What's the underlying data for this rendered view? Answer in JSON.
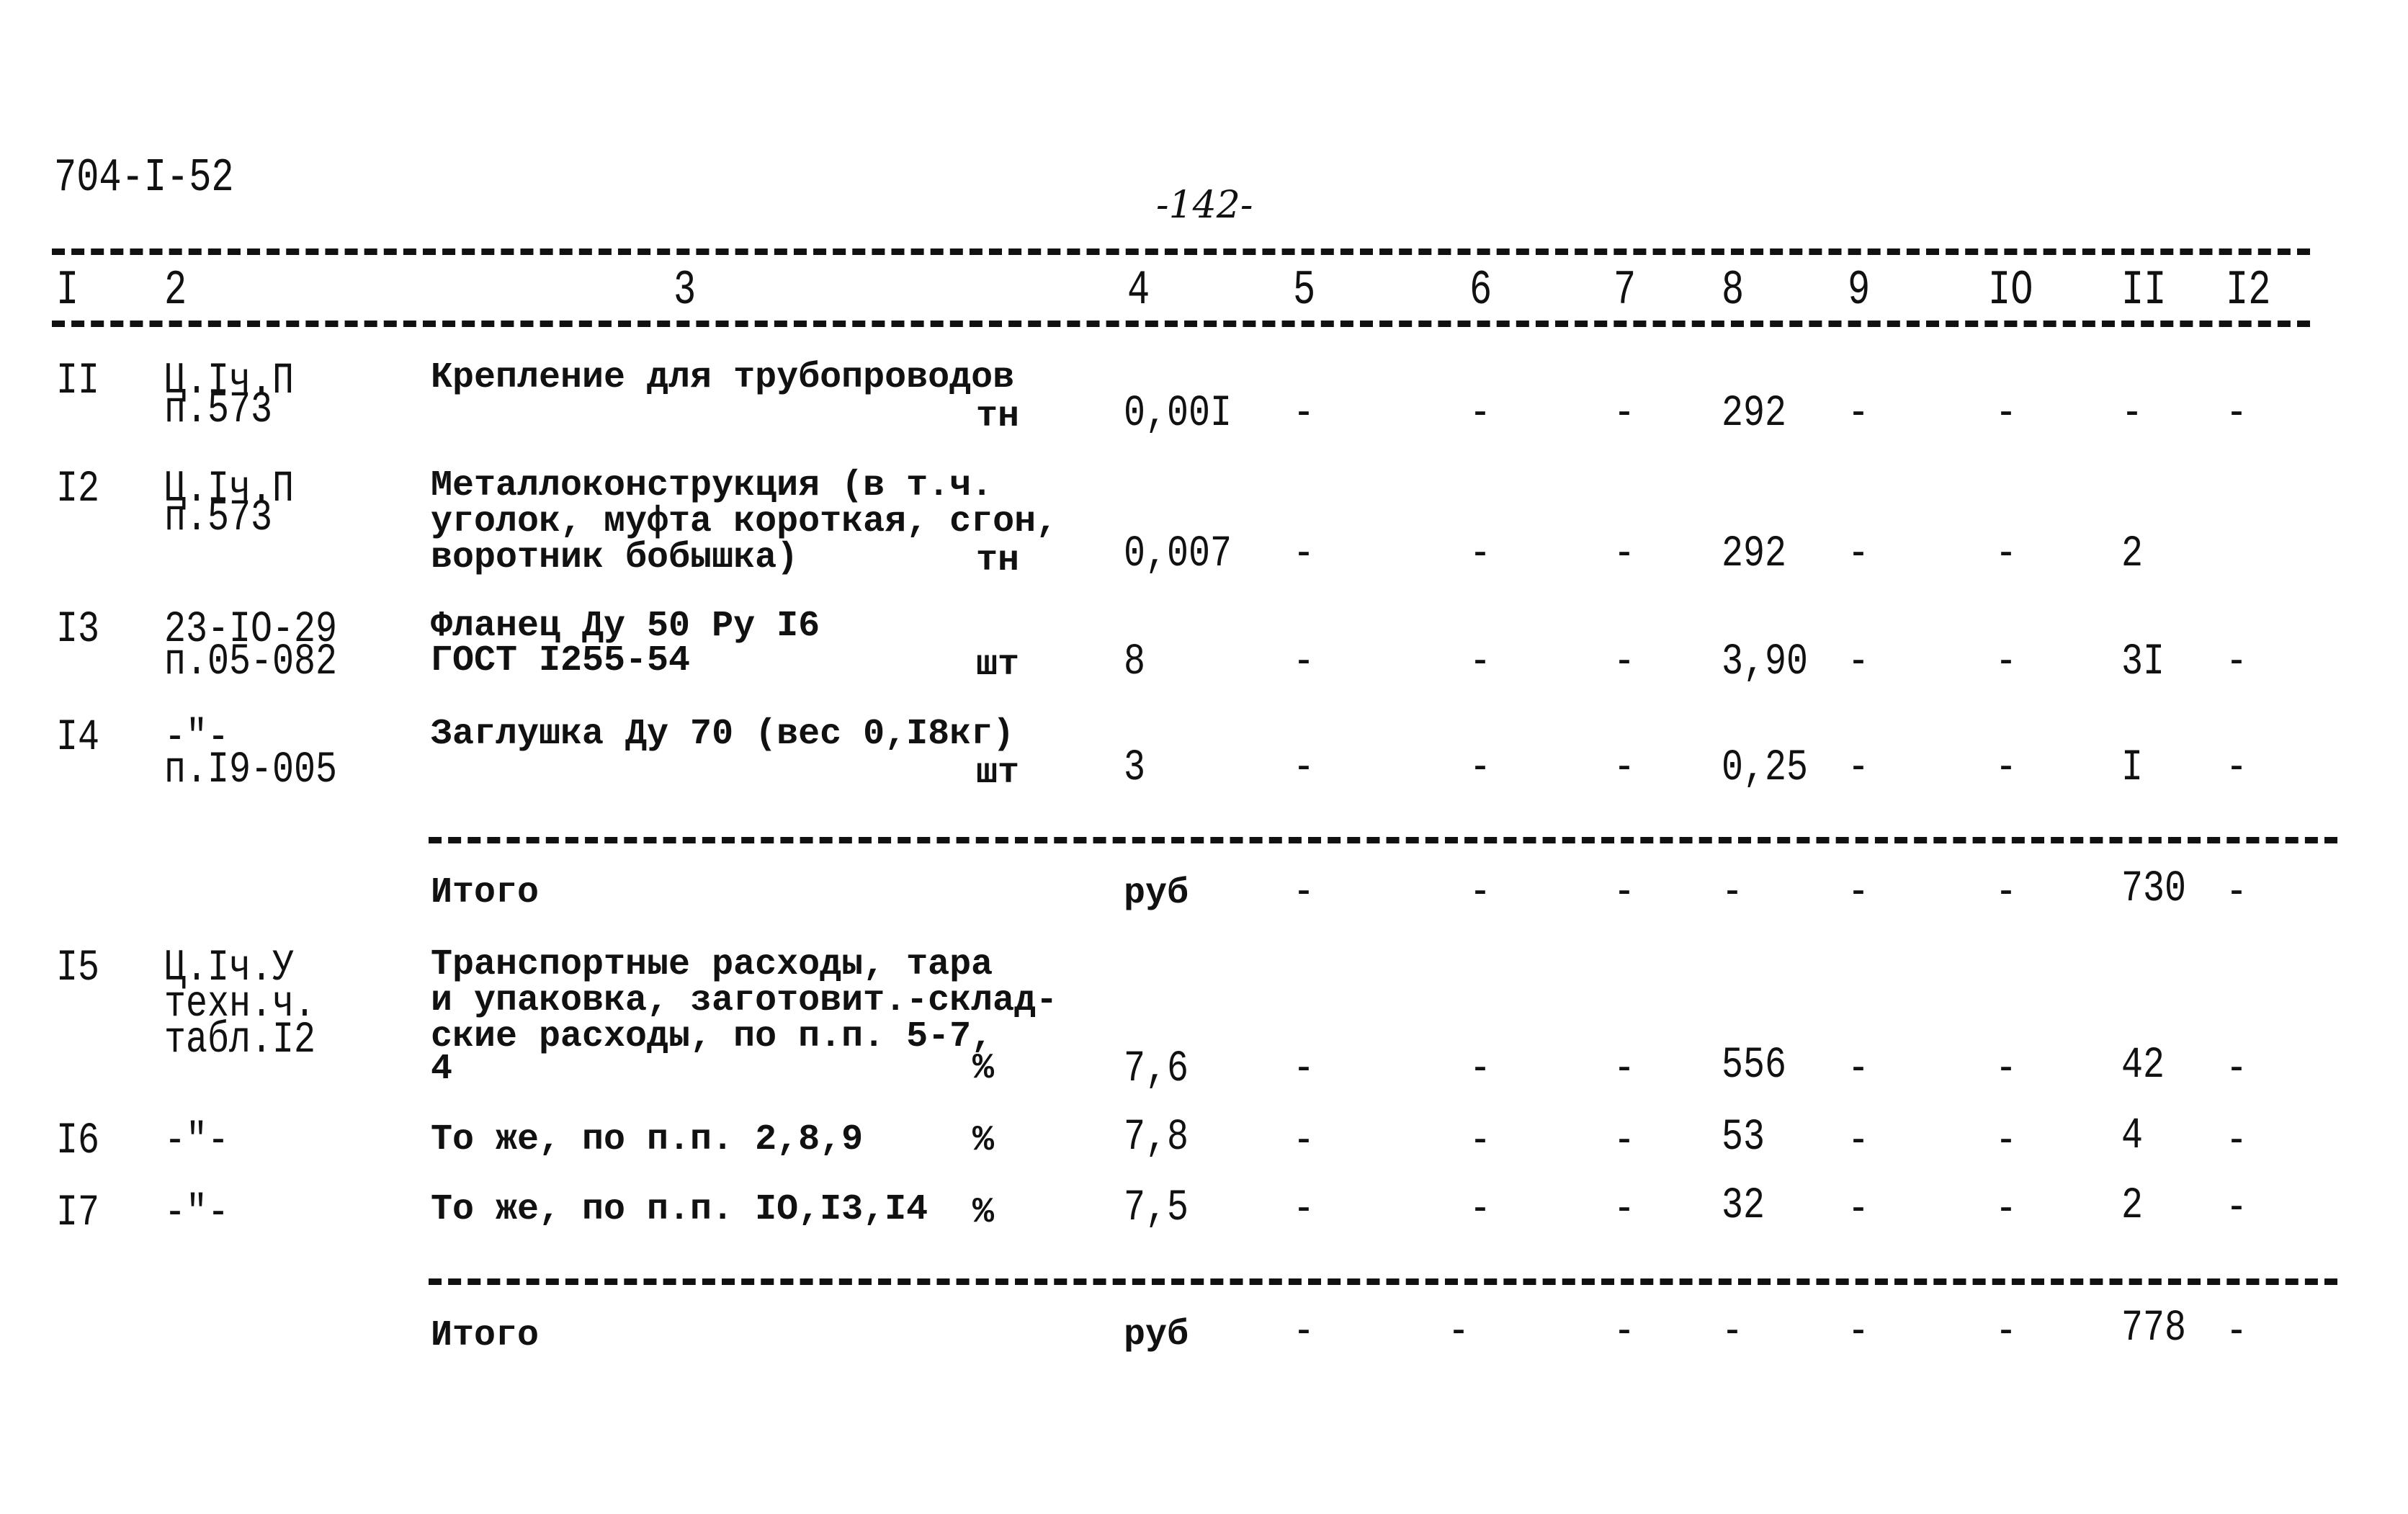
{
  "document": {
    "code": "704-I-52",
    "page_number": "-142-"
  },
  "table": {
    "column_headers": [
      "I",
      "2",
      "3",
      "4",
      "5",
      "6",
      "7",
      "8",
      "9",
      "IO",
      "II",
      "I2"
    ],
    "rows": [
      {
        "num": "II",
        "ref": [
          "Ц.Iч.П",
          "п.573"
        ],
        "desc": [
          "Крепление для трубопроводов"
        ],
        "unit": "тн",
        "c4": "0,00I",
        "c5": "-",
        "c6": "-",
        "c7": "-",
        "c8": "292",
        "c9": "-",
        "c10": "-",
        "c11": "-",
        "c12": "-"
      },
      {
        "num": "I2",
        "ref": [
          "Ц.Iч.П",
          "п.573"
        ],
        "desc": [
          "Металлоконструкция (в т.ч.",
          "уголок, муфта короткая, сгон,",
          "воротник бобышка)"
        ],
        "unit": "тн",
        "c4": "0,007",
        "c5": "-",
        "c6": "-",
        "c7": "-",
        "c8": "292",
        "c9": "-",
        "c10": "-",
        "c11": "2",
        "c12": ""
      },
      {
        "num": "I3",
        "ref": [
          "23-IO-29",
          "п.05-082"
        ],
        "desc": [
          "Фланец Ду 50 Ру I6",
          "ГОСТ I255-54"
        ],
        "unit": "шт",
        "c4": "8",
        "c5": "-",
        "c6": "-",
        "c7": "-",
        "c8": "3,90",
        "c9": "-",
        "c10": "-",
        "c11": "3I",
        "c12": "-"
      },
      {
        "num": "I4",
        "ref": [
          "-\"-",
          "п.I9-005"
        ],
        "desc": [
          "Заглушка Ду 70 (вес 0,I8кг)"
        ],
        "unit": "шт",
        "c4": "3",
        "c5": "-",
        "c6": "-",
        "c7": "-",
        "c8": "0,25",
        "c9": "-",
        "c10": "-",
        "c11": "I",
        "c12": "-"
      }
    ],
    "subtotal1": {
      "label": "Итого",
      "unit": "руб",
      "c5": "-",
      "c6": "-",
      "c7": "-",
      "c8": "-",
      "c9": "-",
      "c10": "-",
      "c11": "730",
      "c12": "-"
    },
    "rows2": [
      {
        "num": "I5",
        "ref": [
          "Ц.Iч.У",
          "техн.ч.",
          "табл.I2"
        ],
        "desc": [
          "Транспортные расходы, тара",
          "и упаковка, заготовит.-склад-",
          "ские расходы, по п.п. 5-7,",
          "4"
        ],
        "unit": "%",
        "c4": "7,6",
        "c5": "-",
        "c6": "-",
        "c7": "-",
        "c8": "556",
        "c9": "-",
        "c10": "-",
        "c11": "42",
        "c12": "-"
      },
      {
        "num": "I6",
        "ref": [
          "-\"-"
        ],
        "desc": [
          "То же, по п.п. 2,8,9"
        ],
        "unit": "%",
        "c4": "7,8",
        "c5": "-",
        "c6": "-",
        "c7": "-",
        "c8": "53",
        "c9": "-",
        "c10": "-",
        "c11": "4",
        "c12": "-"
      },
      {
        "num": "I7",
        "ref": [
          "-\"-"
        ],
        "desc": [
          "То же, по п.п. IO,I3,I4"
        ],
        "unit": "%",
        "c4": "7,5",
        "c5": "-",
        "c6": "-",
        "c7": "-",
        "c8": "32",
        "c9": "-",
        "c10": "-",
        "c11": "2",
        "c12": "-"
      }
    ],
    "subtotal2": {
      "label": "Итого",
      "unit": "руб",
      "c5": "-",
      "c6": "-",
      "c7": "-",
      "c8": "-",
      "c9": "-",
      "c10": "-",
      "c11": "778",
      "c12": "-"
    }
  }
}
